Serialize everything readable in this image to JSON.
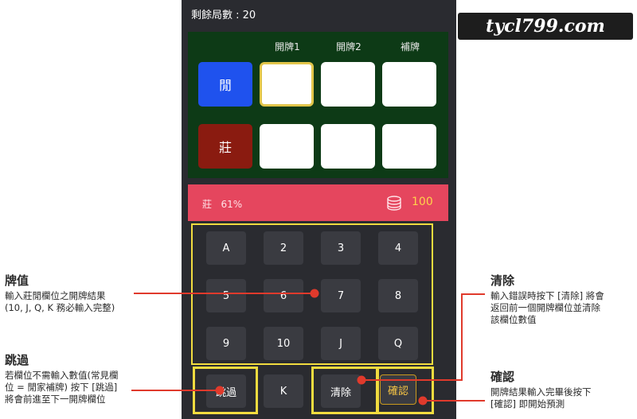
{
  "logo_text": "tycl799.com",
  "status": {
    "remaining": "剩餘局數 : 20"
  },
  "board": {
    "headers": [
      "開牌1",
      "開牌2",
      "補牌"
    ],
    "player_label": "閒",
    "banker_label": "莊",
    "player_color": "#1f52ee",
    "banker_color": "#8a1b10"
  },
  "result": {
    "text": "莊   61%",
    "chip_icon": "chips-icon",
    "amount": "100"
  },
  "keypad": {
    "rows": [
      [
        "A",
        "2",
        "3",
        "4"
      ],
      [
        "5",
        "6",
        "7",
        "8"
      ],
      [
        "9",
        "10",
        "J",
        "Q"
      ]
    ],
    "skip": "跳過",
    "king": "K",
    "clear": "清除",
    "confirm": "確認"
  },
  "annotations": {
    "card_value": {
      "title": "牌值",
      "lines": [
        "輸入莊閒欄位之開牌結果",
        "(10, J, Q, K 務必輸入完整)"
      ]
    },
    "skip": {
      "title": "跳過",
      "lines": [
        "若欄位不需輸入數值(常見欄",
        "位 = 閒家補牌) 按下 [跳過]",
        "將會前進至下一開牌欄位"
      ]
    },
    "clear": {
      "title": "清除",
      "lines": [
        "輸入錯誤時按下 [清除] 將會",
        "返回前一個開牌欄位並清除",
        "該欄位數值"
      ]
    },
    "confirm": {
      "title": "確認",
      "lines": [
        "開牌結果輸入完畢後按下",
        "[確認] 即開始預測"
      ]
    }
  },
  "colors": {
    "accent_red": "#e03a2c",
    "highlight_yellow": "#f1dc3f"
  }
}
